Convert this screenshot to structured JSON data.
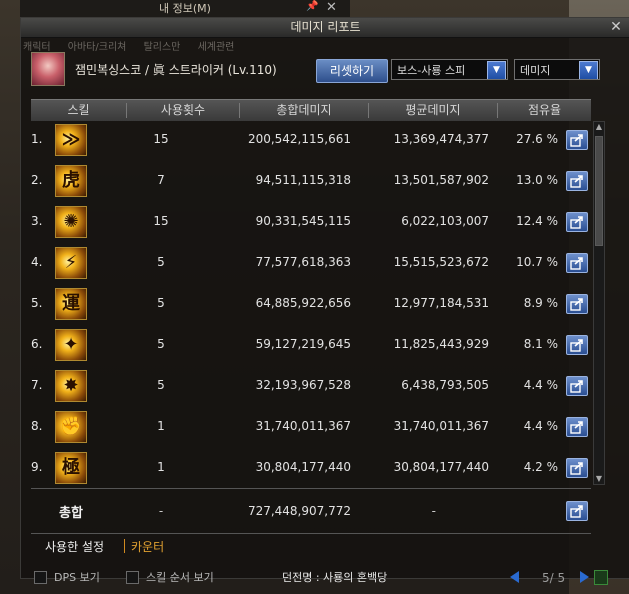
{
  "background": {
    "window_title": "내 정보(M)"
  },
  "panel": {
    "title": "데미지 리포트",
    "faded_tabs": [
      "캐릭터",
      "아바타/크리쳐",
      "탈리스만",
      "세계관련"
    ]
  },
  "character": {
    "name": "잼민복싱스코 / 眞 스트라이커 (Lv.110)"
  },
  "controls": {
    "reset_label": "리셋하기",
    "target_select": "보스-사룡 스피",
    "metric_select": "데미지"
  },
  "table": {
    "headers": {
      "skill": "스킬",
      "uses": "사용횟수",
      "total": "총합데미지",
      "avg": "평균데미지",
      "share": "점유율"
    },
    "rows": [
      {
        "num": "1.",
        "icon_glyph": "≫",
        "icon": "skill-icon-1",
        "uses": "15",
        "total": "200,542,115,661",
        "avg": "13,369,474,377",
        "share": "27.6 %"
      },
      {
        "num": "2.",
        "icon_glyph": "虎",
        "icon": "skill-icon-2",
        "uses": "7",
        "total": "94,511,115,318",
        "avg": "13,501,587,902",
        "share": "13.0 %"
      },
      {
        "num": "3.",
        "icon_glyph": "✺",
        "icon": "skill-icon-3",
        "uses": "15",
        "total": "90,331,545,115",
        "avg": "6,022,103,007",
        "share": "12.4 %"
      },
      {
        "num": "4.",
        "icon_glyph": "⚡",
        "icon": "skill-icon-4",
        "uses": "5",
        "total": "77,577,618,363",
        "avg": "15,515,523,672",
        "share": "10.7 %"
      },
      {
        "num": "5.",
        "icon_glyph": "運",
        "icon": "skill-icon-5",
        "uses": "5",
        "total": "64,885,922,656",
        "avg": "12,977,184,531",
        "share": "8.9 %"
      },
      {
        "num": "6.",
        "icon_glyph": "✦",
        "icon": "skill-icon-6",
        "uses": "5",
        "total": "59,127,219,645",
        "avg": "11,825,443,929",
        "share": "8.1 %"
      },
      {
        "num": "7.",
        "icon_glyph": "✸",
        "icon": "skill-icon-7",
        "uses": "5",
        "total": "32,193,967,528",
        "avg": "6,438,793,505",
        "share": "4.4 %"
      },
      {
        "num": "8.",
        "icon_glyph": "✊",
        "icon": "skill-icon-8",
        "uses": "1",
        "total": "31,740,011,367",
        "avg": "31,740,011,367",
        "share": "4.4 %"
      },
      {
        "num": "9.",
        "icon_glyph": "極",
        "icon": "skill-icon-9",
        "uses": "1",
        "total": "30,804,177,440",
        "avg": "30,804,177,440",
        "share": "4.2 %"
      }
    ]
  },
  "total": {
    "label": "총합",
    "uses": "-",
    "total": "727,448,907,772",
    "avg": "-"
  },
  "bottom_tabs": {
    "used_settings": "사용한 설정",
    "counter": "카운터"
  },
  "footer": {
    "dps_label": "DPS 보기",
    "skill_order_label": "스킬 순서 보기",
    "dungeon_name": "던전명 : 사룡의 혼백당",
    "page": "5/ 5"
  },
  "colors": {
    "accent_blue": "#3a62ae",
    "counter_orange": "#e0a030"
  }
}
